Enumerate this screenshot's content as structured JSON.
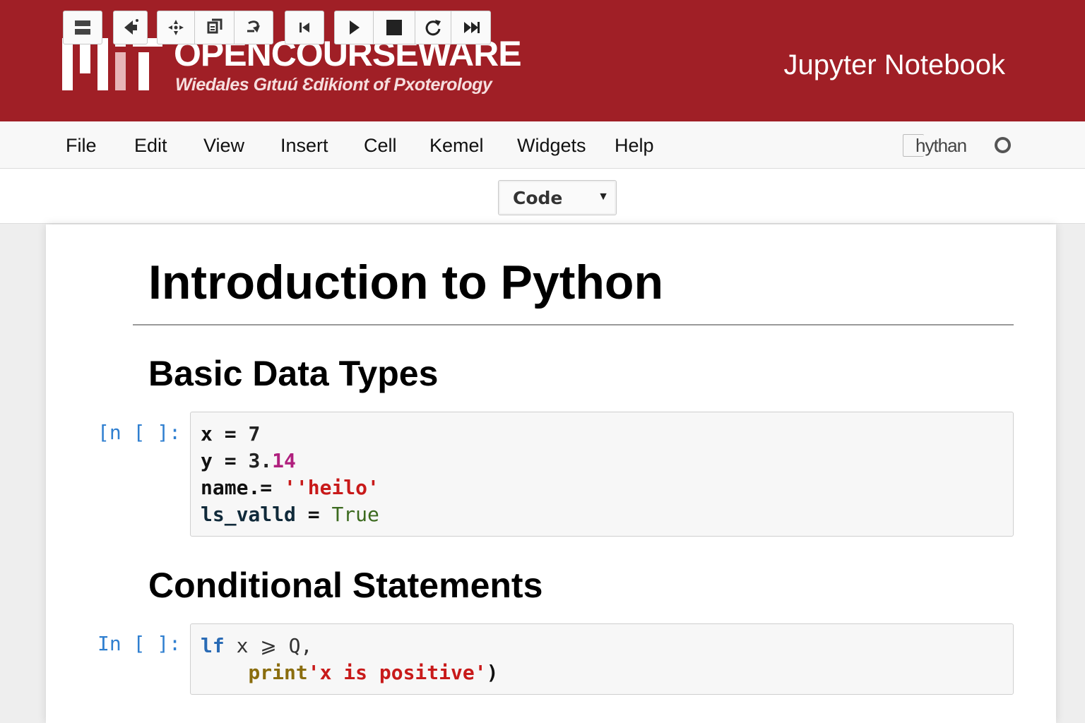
{
  "header": {
    "brand_title": "OPENCOURSEWARE",
    "brand_subtitle": "Wiedales Gıtuú Ɛdikiont of Pxoterology",
    "app_title": "Jupyter Notebook",
    "colors": {
      "banner": "#a01f26",
      "text": "#ffffff"
    }
  },
  "menubar": {
    "items": [
      "File",
      "Edit",
      "View",
      "Insert",
      "Cell",
      "Kemel",
      "Widgets",
      "Help"
    ],
    "kernel_name": "hythan"
  },
  "toolbar": {
    "icons": [
      "save-icon",
      "add-cell-icon",
      "cut-icon",
      "copy-icon",
      "paste-icon",
      "move-up-icon",
      "run-icon",
      "stop-icon",
      "restart-icon",
      "fast-forward-icon"
    ],
    "cell_type": "Code"
  },
  "notebook": {
    "title": "Introduction to Python",
    "sections": [
      {
        "heading": "Basic Data Types",
        "prompt": "[n [ ]:",
        "code": [
          {
            "a": "x",
            "b": " = ",
            "c": "7"
          },
          {
            "a": "y",
            "b": " = ",
            "c": "3.",
            "d": "14"
          },
          {
            "a": "name",
            "b": ".= ",
            "c": "''heilo'"
          },
          {
            "a": "ls_valld",
            "b": " = ",
            "c": "True"
          }
        ]
      },
      {
        "heading": "Conditional Statements",
        "prompt": "In [ ]:",
        "code": [
          {
            "a": "lf",
            "b": " x ",
            "c": "⩾",
            "d": " Q,",
            "e": ""
          },
          {
            "a": "    print",
            "b": "'x is positive'",
            "c": ")"
          }
        ]
      }
    ]
  }
}
